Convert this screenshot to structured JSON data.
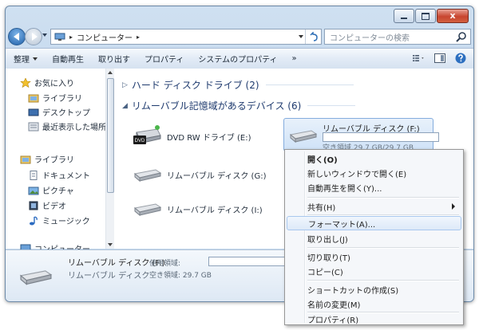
{
  "window": {
    "close_symbol": "x"
  },
  "address": {
    "separator": "▸",
    "path": "コンピューター",
    "search_placeholder": "コンピューターの検索"
  },
  "commands": [
    {
      "label": "整理",
      "has_dropdown": true
    },
    {
      "label": "自動再生",
      "has_dropdown": false
    },
    {
      "label": "取り出す",
      "has_dropdown": false
    },
    {
      "label": "プロパティ",
      "has_dropdown": false
    },
    {
      "label": "システムのプロパティ",
      "has_dropdown": false
    },
    {
      "label": "»",
      "has_dropdown": false
    }
  ],
  "sidebar": {
    "favorites": "お気に入り",
    "fav_items": [
      "ライブラリ",
      "デスクトップ",
      "最近表示した場所"
    ],
    "libraries": "ライブラリ",
    "lib_items": [
      "ドキュメント",
      "ピクチャ",
      "ビデオ",
      "ミュージック"
    ],
    "computer": "コンピューター"
  },
  "groups": {
    "hdd": "ハード ディスク ドライブ (2)",
    "removable": "リムーバブル記憶域があるデバイス (6)"
  },
  "drives": {
    "dvd": "DVD RW ドライブ (E:)",
    "dvd_badge": "DVD",
    "g": "リムーバブル ディスク (G:)",
    "i": "リムーバブル ディスク (I:)",
    "f": "リムーバブル ディスク (F:)",
    "f_free": "空き領域 29.7 GB/29.7 GB"
  },
  "details": {
    "name": "リムーバブル ディスク (F:)",
    "type": "リムーバブル ディスク",
    "used_label": "使用領域:",
    "free": "空き領域: 29.7 GB"
  },
  "context_menu": [
    {
      "label": "開く(O)",
      "bold": true
    },
    {
      "label": "新しいウィンドウで開く(E)"
    },
    {
      "label": "自動再生を開く(Y)..."
    },
    {
      "sep": true
    },
    {
      "label": "共有(H)",
      "submenu": true
    },
    {
      "sep": true
    },
    {
      "label": "フォーマット(A)...",
      "hover": true
    },
    {
      "label": "取り出し(J)"
    },
    {
      "sep": true
    },
    {
      "label": "切り取り(T)"
    },
    {
      "label": "コピー(C)"
    },
    {
      "sep": true
    },
    {
      "label": "ショートカットの作成(S)"
    },
    {
      "label": "名前の変更(M)"
    },
    {
      "sep": true
    },
    {
      "label": "プロパティ(R)"
    }
  ]
}
